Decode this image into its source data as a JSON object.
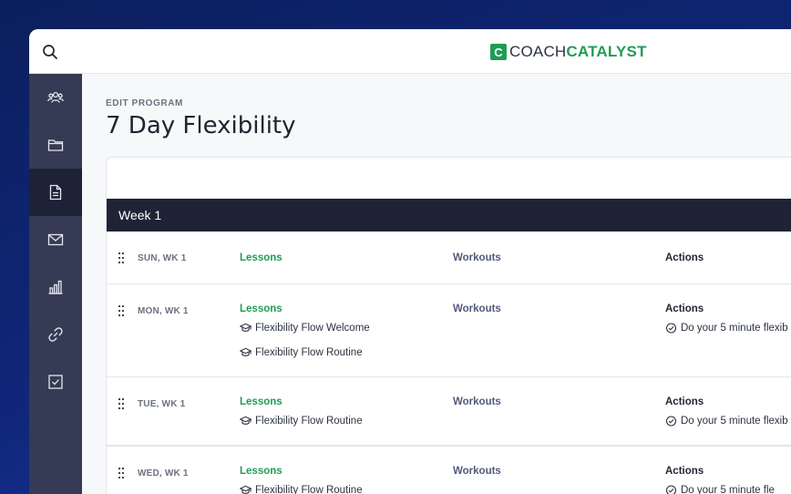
{
  "brand": {
    "logo_mark": "C",
    "logo_left": "COACH",
    "logo_right": "CATALYST",
    "accent": "#1f9d55"
  },
  "sidebar": {
    "items": [
      {
        "name": "users-icon",
        "active": false
      },
      {
        "name": "folder-icon",
        "active": false
      },
      {
        "name": "document-icon",
        "active": true
      },
      {
        "name": "mail-icon",
        "active": false
      },
      {
        "name": "chart-icon",
        "active": false
      },
      {
        "name": "link-icon",
        "active": false
      },
      {
        "name": "checkbox-icon",
        "active": false
      }
    ]
  },
  "page": {
    "eyebrow": "EDIT PROGRAM",
    "title": "7 Day Flexibility"
  },
  "week": {
    "label": "Week 1"
  },
  "columns": {
    "lessons": "Lessons",
    "workouts": "Workouts",
    "actions": "Actions"
  },
  "days": [
    {
      "label": "SUN, WK 1",
      "lessons": [],
      "actions": []
    },
    {
      "label": "MON, WK 1",
      "lessons": [
        "Flexibility Flow Welcome",
        "Flexibility Flow Routine"
      ],
      "actions": [
        "Do your 5 minute flexib"
      ]
    },
    {
      "label": "TUE, WK 1",
      "lessons": [
        "Flexibility Flow Routine"
      ],
      "actions": [
        "Do your 5 minute flexib"
      ]
    },
    {
      "label": "WED, WK 1",
      "lessons": [
        "Flexibility Flow Routine"
      ],
      "actions": [
        "Do your 5 minute fle"
      ]
    }
  ]
}
